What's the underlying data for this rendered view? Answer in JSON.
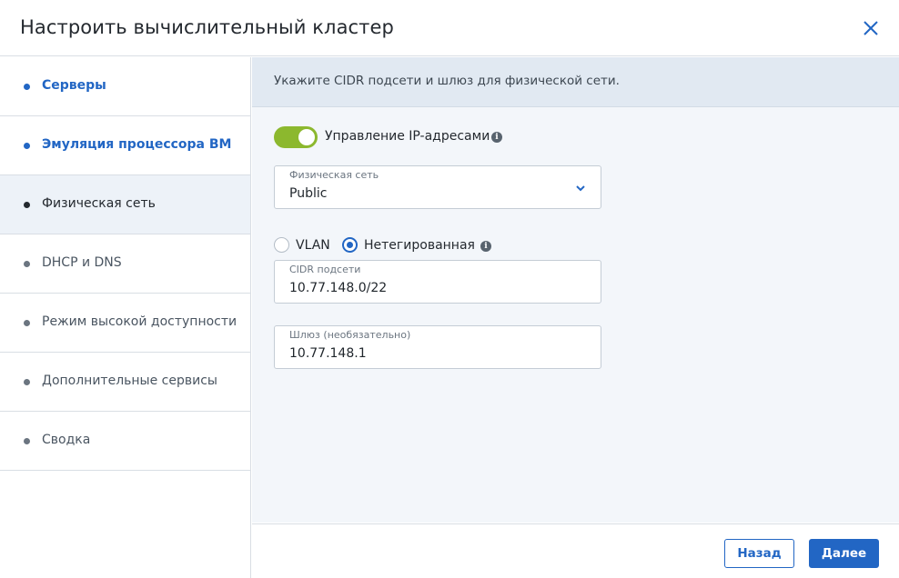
{
  "dialog": {
    "title": "Настроить вычислительный кластер",
    "close_icon": "close-icon"
  },
  "steps": [
    {
      "label": "Серверы",
      "state": "done"
    },
    {
      "label": "Эмуляция процессора ВМ",
      "state": "done"
    },
    {
      "label": "Физическая сеть",
      "state": "current"
    },
    {
      "label": "DHCP и DNS",
      "state": "pending"
    },
    {
      "label": "Режим высокой доступности",
      "state": "pending"
    },
    {
      "label": "Дополнительные сервисы",
      "state": "pending"
    },
    {
      "label": "Сводка",
      "state": "pending"
    }
  ],
  "main": {
    "banner": "Укажите CIDR подсети и шлюз для физической сети.",
    "ip_management": {
      "label": "Управление IP-адресами",
      "enabled": true
    },
    "physical_network": {
      "label": "Физическая сеть",
      "value": "Public"
    },
    "network_type": {
      "options": [
        {
          "label": "VLAN",
          "checked": false
        },
        {
          "label": "Нетегированная",
          "checked": true
        }
      ]
    },
    "cidr": {
      "label": "CIDR подсети",
      "value": "10.77.148.0/22"
    },
    "gateway": {
      "label": "Шлюз (необязательно)",
      "value": "10.77.148.1"
    }
  },
  "footer": {
    "back_label": "Назад",
    "next_label": "Далее"
  },
  "colors": {
    "accent": "#2266c4",
    "toggle_on": "#8cb82e",
    "banner_bg": "#e1e9f2",
    "panel_bg": "#f3f6fa"
  }
}
